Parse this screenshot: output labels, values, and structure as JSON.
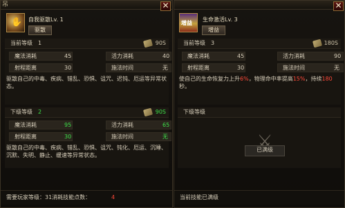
{
  "header": {
    "partial_title": "吊"
  },
  "left": {
    "skill_name": "自我驱散Lv. 1",
    "type_tag": "驱散",
    "current": {
      "label": "当前等级",
      "level": "1",
      "cost": "90S",
      "stats": {
        "magic_cost_label": "魔法消耗",
        "magic_cost": "45",
        "vitality_cost_label": "活力消耗",
        "vitality_cost": "40",
        "range_label": "射程距离",
        "range": "30",
        "cast_time_label": "施法时间",
        "cast_time": "无"
      },
      "description": "驱散自己的中毒、疾病、错乱、恐惧、诅咒、迟钝、厄运等异常状态。"
    },
    "next": {
      "label": "下级等级",
      "level": "2",
      "cost": "90S",
      "stats": {
        "magic_cost_label": "魔法消耗",
        "magic_cost": "95",
        "vitality_cost_label": "活力消耗",
        "vitality_cost": "65",
        "range_label": "射程距离",
        "range": "30",
        "cast_time_label": "施法时间",
        "cast_time": "无"
      },
      "description": "驱散自己的中毒、疾病、错乱、恐惧、诅咒、钝化、厄运、沉睡、沉默、失明、静止、缓速等异常状态。"
    },
    "footer": {
      "text": "需要玩家等级：31消耗技能点数：",
      "points": "4"
    }
  },
  "right": {
    "skill_name": "生命激活Lv. 3",
    "type_tag": "增益",
    "icon_text": "增益",
    "current": {
      "label": "当前等级",
      "level": "3",
      "cost": "180S",
      "stats": {
        "magic_cost_label": "魔法消耗",
        "magic_cost": "45",
        "vitality_cost_label": "活力消耗",
        "vitality_cost": "90",
        "range_label": "射程距离",
        "range": "30",
        "cast_time_label": "施法时间",
        "cast_time": "无"
      },
      "desc_a": "使自己的生命恢复力上升",
      "desc_pct1": "6%",
      "desc_b": "，物理命中率提高",
      "desc_pct2": "15%",
      "desc_c": "，持续",
      "desc_secs": "180",
      "desc_d": "秒。"
    },
    "next": {
      "label": "下级等级"
    },
    "maxed_label": "已满级",
    "footer": {
      "text": "当前技能已满级"
    }
  },
  "colors": {
    "accent_green": "#3ee24a",
    "accent_red": "#ff4a3a",
    "frame_gold": "#b58e48"
  }
}
